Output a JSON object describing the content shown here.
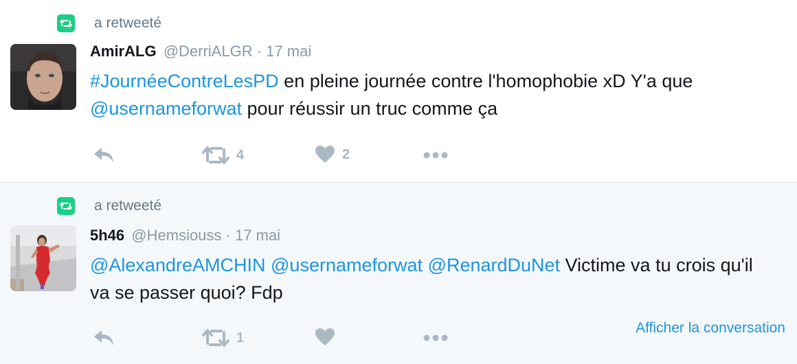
{
  "tweets": [
    {
      "retweet_label": "a retweeté",
      "name": "AmirALG",
      "handle": "@DerriALGR",
      "sep": "·",
      "date": "17 mai",
      "text": {
        "hashtag": "#JournéeContreLesPD",
        "part1": " en pleine journée contre l'homophobie xD Y'a que ",
        "mention": "@usernameforwat",
        "part2": " pour réussir un truc comme ça"
      },
      "retweet_count": "4",
      "like_count": "2"
    },
    {
      "retweet_label": "a retweeté",
      "name": "5h46",
      "handle": "@Hemsiouss",
      "sep": "·",
      "date": "17 mai",
      "text": {
        "mention1": "@AlexandreAMCHIN",
        "mention2": "@usernameforwat",
        "mention3": "@RenardDuNet",
        "rest": " Victime va tu crois qu'il va se passer quoi? Fdp"
      },
      "retweet_count": "1",
      "like_count": "",
      "show_conversation": "Afficher la conversation"
    }
  ],
  "icons": {
    "retweet_badge": "retweet-icon",
    "reply": "reply-icon",
    "retweet": "retweet-icon",
    "like": "heart-icon",
    "more": "more-icon"
  },
  "colors": {
    "retweet_green": "#19cf86",
    "link_blue": "#1b95e0",
    "muted_gray": "#8899a6",
    "action_gray": "#aab8c2",
    "alt_background": "#f5f8fa"
  }
}
